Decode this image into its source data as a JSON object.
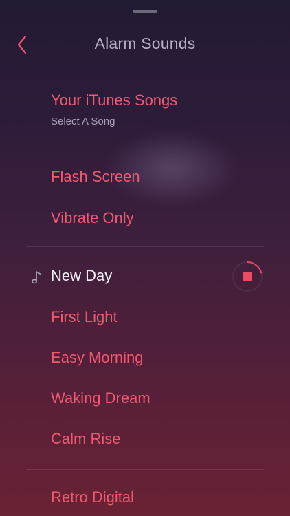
{
  "header": {
    "title": "Alarm Sounds",
    "back_icon": "chevron-left-icon"
  },
  "itunes": {
    "label": "Your iTunes Songs",
    "sublabel": "Select A Song"
  },
  "options": [
    "Flash Screen",
    "Vibrate Only"
  ],
  "sounds": {
    "playing": "New Day",
    "items": [
      "First Light",
      "Easy Morning",
      "Waking Dream",
      "Calm Rise"
    ]
  },
  "more": [
    "Retro Digital"
  ],
  "colors": {
    "accent": "#f0596f",
    "active_text": "#f3f0f5",
    "muted_text": "#b6b1c0"
  }
}
